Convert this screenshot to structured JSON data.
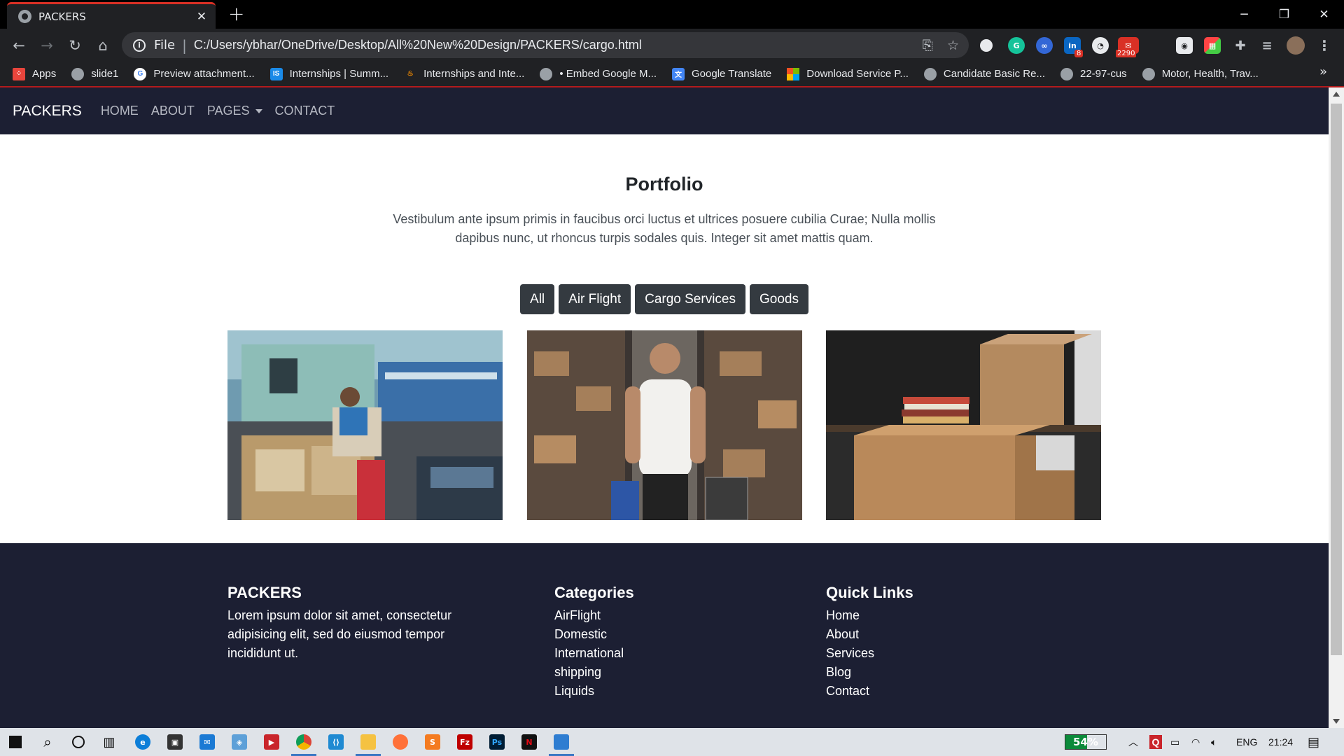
{
  "browser": {
    "tab_title": "PACKERS",
    "scheme_label": "File",
    "url": "C:/Users/ybhar/OneDrive/Desktop/All%20New%20Design/PACKERS/cargo.html",
    "extension_badges": {
      "linkedin": "8",
      "mail": "2290"
    },
    "bookmarks": [
      {
        "label": "Apps",
        "icon": "apps-grid-icon",
        "color": "#e8453c"
      },
      {
        "label": "slide1",
        "icon": "globe-icon",
        "color": "#9aa0a6"
      },
      {
        "label": "Preview attachment...",
        "icon": "google-icon",
        "color": "#ffffff"
      },
      {
        "label": "Internships | Summ...",
        "icon": "is-icon",
        "color": "#1a8ae8"
      },
      {
        "label": "Internships and Inte...",
        "icon": "flame-icon",
        "color": "#f28b00"
      },
      {
        "label": "• Embed Google M...",
        "icon": "globe-icon",
        "color": "#9aa0a6"
      },
      {
        "label": "Google Translate",
        "icon": "translate-icon",
        "color": "#4285f4"
      },
      {
        "label": "Download Service P...",
        "icon": "windows-icon",
        "color": "#f25022"
      },
      {
        "label": "Candidate Basic Re...",
        "icon": "globe-icon",
        "color": "#9aa0a6"
      },
      {
        "label": "22-97-cus",
        "icon": "globe-icon",
        "color": "#9aa0a6"
      },
      {
        "label": "Motor, Health, Trav...",
        "icon": "globe-icon",
        "color": "#9aa0a6"
      }
    ]
  },
  "site": {
    "brand": "PACKERS",
    "nav": [
      "HOME",
      "ABOUT",
      "PAGES",
      "CONTACT"
    ],
    "portfolio": {
      "title": "Portfolio",
      "description": "Vestibulum ante ipsum primis in faucibus orci luctus et ultrices posuere cubilia Curae; Nulla mollis dapibus nunc, ut rhoncus turpis sodales quis. Integer sit amet mattis quam.",
      "filters": [
        "All",
        "Air Flight",
        "Cargo Services",
        "Goods"
      ]
    },
    "footer": {
      "about_title": "PACKERS",
      "about_text": "Lorem ipsum dolor sit amet, consectetur adipisicing elit, sed do eiusmod tempor incididunt ut.",
      "categories_title": "Categories",
      "categories": [
        "AirFlight",
        "Domestic",
        "International",
        "shipping",
        "Liquids"
      ],
      "links_title": "Quick Links",
      "links": [
        "Home",
        "About",
        "Services",
        "Blog",
        "Contact"
      ]
    },
    "colors": {
      "nav_bg": "#1c1f33",
      "filter_bg": "#343a40"
    }
  },
  "taskbar": {
    "battery_percent": "54%",
    "language": "ENG",
    "time": "21:24"
  }
}
